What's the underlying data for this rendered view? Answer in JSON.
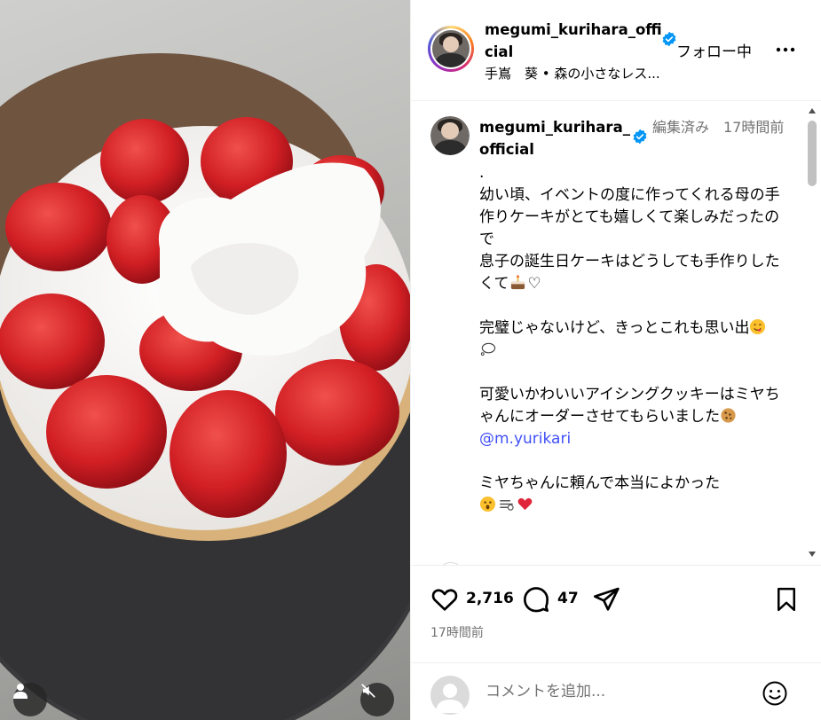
{
  "post": {
    "username": "megumi_kurihara_official",
    "follow_status": "フォロー中",
    "subtitle": "手嶌　葵 • 森の小さなレス...",
    "more_icon": "more-horizontal-icon",
    "verified_color": "#0095f6"
  },
  "caption": {
    "username": "megumi_kurihara_official",
    "edited": "編集済み",
    "time": "17時間前",
    "lines": [
      ".",
      "幼い頃、イベントの度に作ってくれる母の手作りケーキがとても嬉しくて楽しみだったので",
      "息子の誕生日ケーキはどうしても手作りしたくて",
      "",
      "完璧じゃないけど、きっとこれも思い出",
      "",
      "可愛いかわいいアイシングクッキーはミヤちゃんにオーダーさせてもらいました",
      "@m.yurikari",
      "",
      "ミヤちゃんに頼んで本当によかった"
    ],
    "mention_color": "#4150f7"
  },
  "actions": {
    "likes": "2,716",
    "comments": "47",
    "timestamp": "17時間前"
  },
  "comment_input": {
    "placeholder": "コメントを追加..."
  }
}
